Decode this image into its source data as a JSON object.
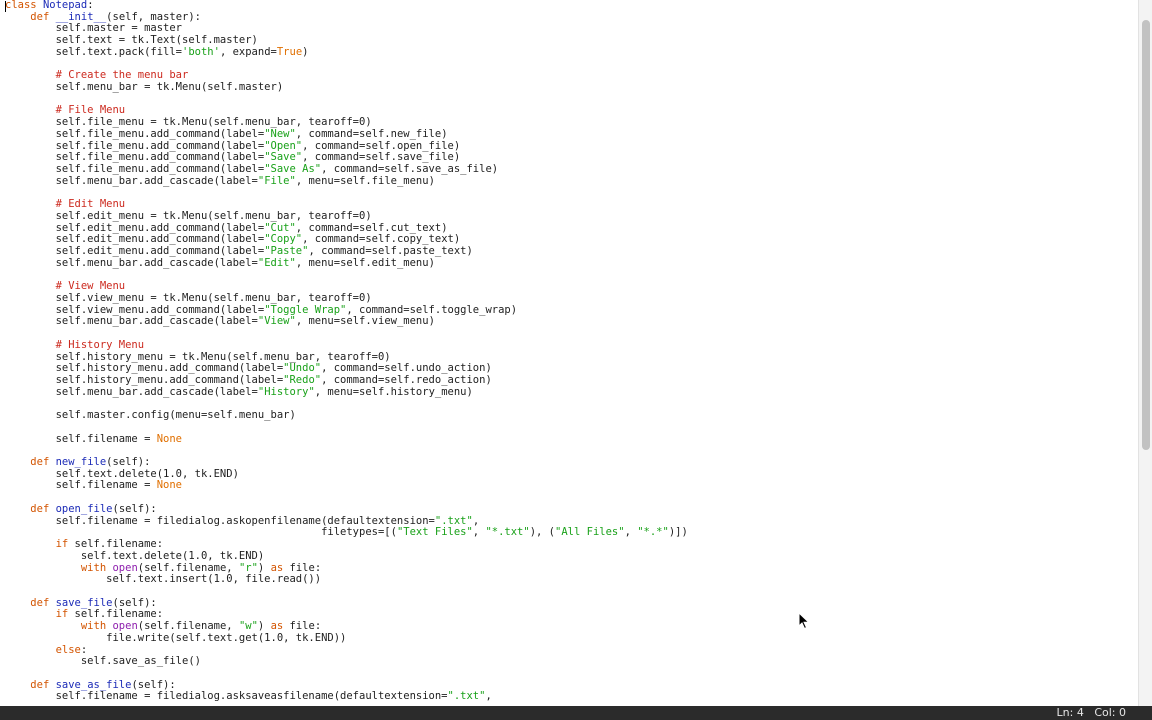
{
  "editor": {
    "lines": [
      [
        [
          "class",
          "kw"
        ],
        [
          " "
        ],
        [
          "Notepad",
          "def"
        ],
        [
          ":"
        ]
      ],
      [
        [
          "    "
        ],
        [
          "def",
          "kw"
        ],
        [
          " "
        ],
        [
          "__init__",
          "def"
        ],
        [
          "(self, master):"
        ]
      ],
      [
        [
          "        self.master = master"
        ]
      ],
      [
        [
          "        self.text = tk.Text(self.master)"
        ]
      ],
      [
        [
          "        self.text.pack(fill="
        ],
        [
          "'both'",
          "str"
        ],
        [
          ", expand="
        ],
        [
          "True",
          "const"
        ],
        [
          ")"
        ]
      ],
      [
        [
          ""
        ]
      ],
      [
        [
          "        "
        ],
        [
          "# Create the menu bar",
          "com"
        ]
      ],
      [
        [
          "        self.menu_bar = tk.Menu(self.master)"
        ]
      ],
      [
        [
          ""
        ]
      ],
      [
        [
          "        "
        ],
        [
          "# File Menu",
          "com"
        ]
      ],
      [
        [
          "        self.file_menu = tk.Menu(self.menu_bar, tearoff=0)"
        ]
      ],
      [
        [
          "        self.file_menu.add_command(label="
        ],
        [
          "\"New\"",
          "str"
        ],
        [
          ", command=self.new_file)"
        ]
      ],
      [
        [
          "        self.file_menu.add_command(label="
        ],
        [
          "\"Open\"",
          "str"
        ],
        [
          ", command=self.open_file)"
        ]
      ],
      [
        [
          "        self.file_menu.add_command(label="
        ],
        [
          "\"Save\"",
          "str"
        ],
        [
          ", command=self.save_file)"
        ]
      ],
      [
        [
          "        self.file_menu.add_command(label="
        ],
        [
          "\"Save As\"",
          "str"
        ],
        [
          ", command=self.save_as_file)"
        ]
      ],
      [
        [
          "        self.menu_bar.add_cascade(label="
        ],
        [
          "\"File\"",
          "str"
        ],
        [
          ", menu=self.file_menu)"
        ]
      ],
      [
        [
          ""
        ]
      ],
      [
        [
          "        "
        ],
        [
          "# Edit Menu",
          "com"
        ]
      ],
      [
        [
          "        self.edit_menu = tk.Menu(self.menu_bar, tearoff=0)"
        ]
      ],
      [
        [
          "        self.edit_menu.add_command(label="
        ],
        [
          "\"Cut\"",
          "str"
        ],
        [
          ", command=self.cut_text)"
        ]
      ],
      [
        [
          "        self.edit_menu.add_command(label="
        ],
        [
          "\"Copy\"",
          "str"
        ],
        [
          ", command=self.copy_text)"
        ]
      ],
      [
        [
          "        self.edit_menu.add_command(label="
        ],
        [
          "\"Paste\"",
          "str"
        ],
        [
          ", command=self.paste_text)"
        ]
      ],
      [
        [
          "        self.menu_bar.add_cascade(label="
        ],
        [
          "\"Edit\"",
          "str"
        ],
        [
          ", menu=self.edit_menu)"
        ]
      ],
      [
        [
          ""
        ]
      ],
      [
        [
          "        "
        ],
        [
          "# View Menu",
          "com"
        ]
      ],
      [
        [
          "        self.view_menu = tk.Menu(self.menu_bar, tearoff=0)"
        ]
      ],
      [
        [
          "        self.view_menu.add_command(label="
        ],
        [
          "\"Toggle Wrap\"",
          "str"
        ],
        [
          ", command=self.toggle_wrap)"
        ]
      ],
      [
        [
          "        self.menu_bar.add_cascade(label="
        ],
        [
          "\"View\"",
          "str"
        ],
        [
          ", menu=self.view_menu)"
        ]
      ],
      [
        [
          ""
        ]
      ],
      [
        [
          "        "
        ],
        [
          "# History Menu",
          "com"
        ]
      ],
      [
        [
          "        self.history_menu = tk.Menu(self.menu_bar, tearoff=0)"
        ]
      ],
      [
        [
          "        self.history_menu.add_command(label="
        ],
        [
          "\"Undo\"",
          "str"
        ],
        [
          ", command=self.undo_action)"
        ]
      ],
      [
        [
          "        self.history_menu.add_command(label="
        ],
        [
          "\"Redo\"",
          "str"
        ],
        [
          ", command=self.redo_action)"
        ]
      ],
      [
        [
          "        self.menu_bar.add_cascade(label="
        ],
        [
          "\"History\"",
          "str"
        ],
        [
          ", menu=self.history_menu)"
        ]
      ],
      [
        [
          ""
        ]
      ],
      [
        [
          "        self.master.config(menu=self.menu_bar)"
        ]
      ],
      [
        [
          ""
        ]
      ],
      [
        [
          "        self.filename = "
        ],
        [
          "None",
          "const"
        ]
      ],
      [
        [
          ""
        ]
      ],
      [
        [
          "    "
        ],
        [
          "def",
          "kw"
        ],
        [
          " "
        ],
        [
          "new_file",
          "def"
        ],
        [
          "(self):"
        ]
      ],
      [
        [
          "        self.text.delete(1.0, tk.END)"
        ]
      ],
      [
        [
          "        self.filename = "
        ],
        [
          "None",
          "const"
        ]
      ],
      [
        [
          ""
        ]
      ],
      [
        [
          "    "
        ],
        [
          "def",
          "kw"
        ],
        [
          " "
        ],
        [
          "open_file",
          "def"
        ],
        [
          "(self):"
        ]
      ],
      [
        [
          "        self.filename = filedialog.askopenfilename(defaultextension="
        ],
        [
          "\".txt\"",
          "str"
        ],
        [
          ","
        ]
      ],
      [
        [
          "                                                  filetypes=[("
        ],
        [
          "\"Text Files\"",
          "str"
        ],
        [
          ", "
        ],
        [
          "\"*.txt\"",
          "str"
        ],
        [
          "), ("
        ],
        [
          "\"All Files\"",
          "str"
        ],
        [
          ", "
        ],
        [
          "\"*.*\"",
          "str"
        ],
        [
          ")])"
        ]
      ],
      [
        [
          "        "
        ],
        [
          "if",
          "kw"
        ],
        [
          " self.filename:"
        ]
      ],
      [
        [
          "            self.text.delete(1.0, tk.END)"
        ]
      ],
      [
        [
          "            "
        ],
        [
          "with",
          "kw"
        ],
        [
          " "
        ],
        [
          "open",
          "bi"
        ],
        [
          "(self.filename, "
        ],
        [
          "\"r\"",
          "str"
        ],
        [
          ") "
        ],
        [
          "as",
          "kw"
        ],
        [
          " file:"
        ]
      ],
      [
        [
          "                self.text.insert(1.0, file.read())"
        ]
      ],
      [
        [
          ""
        ]
      ],
      [
        [
          "    "
        ],
        [
          "def",
          "kw"
        ],
        [
          " "
        ],
        [
          "save_file",
          "def"
        ],
        [
          "(self):"
        ]
      ],
      [
        [
          "        "
        ],
        [
          "if",
          "kw"
        ],
        [
          " self.filename:"
        ]
      ],
      [
        [
          "            "
        ],
        [
          "with",
          "kw"
        ],
        [
          " "
        ],
        [
          "open",
          "bi"
        ],
        [
          "(self.filename, "
        ],
        [
          "\"w\"",
          "str"
        ],
        [
          ") "
        ],
        [
          "as",
          "kw"
        ],
        [
          " file:"
        ]
      ],
      [
        [
          "                file.write(self.text.get(1.0, tk.END))"
        ]
      ],
      [
        [
          "        "
        ],
        [
          "else",
          "kw"
        ],
        [
          ":"
        ]
      ],
      [
        [
          "            self.save_as_file()"
        ]
      ],
      [
        [
          ""
        ]
      ],
      [
        [
          "    "
        ],
        [
          "def",
          "kw"
        ],
        [
          " "
        ],
        [
          "save_as_file",
          "def"
        ],
        [
          "(self):"
        ]
      ],
      [
        [
          "        self.filename = filedialog.asksaveasfilename(defaultextension="
        ],
        [
          "\".txt\"",
          "str"
        ],
        [
          ","
        ]
      ]
    ]
  },
  "status": {
    "position": "Ln: 4   Col: 0"
  }
}
